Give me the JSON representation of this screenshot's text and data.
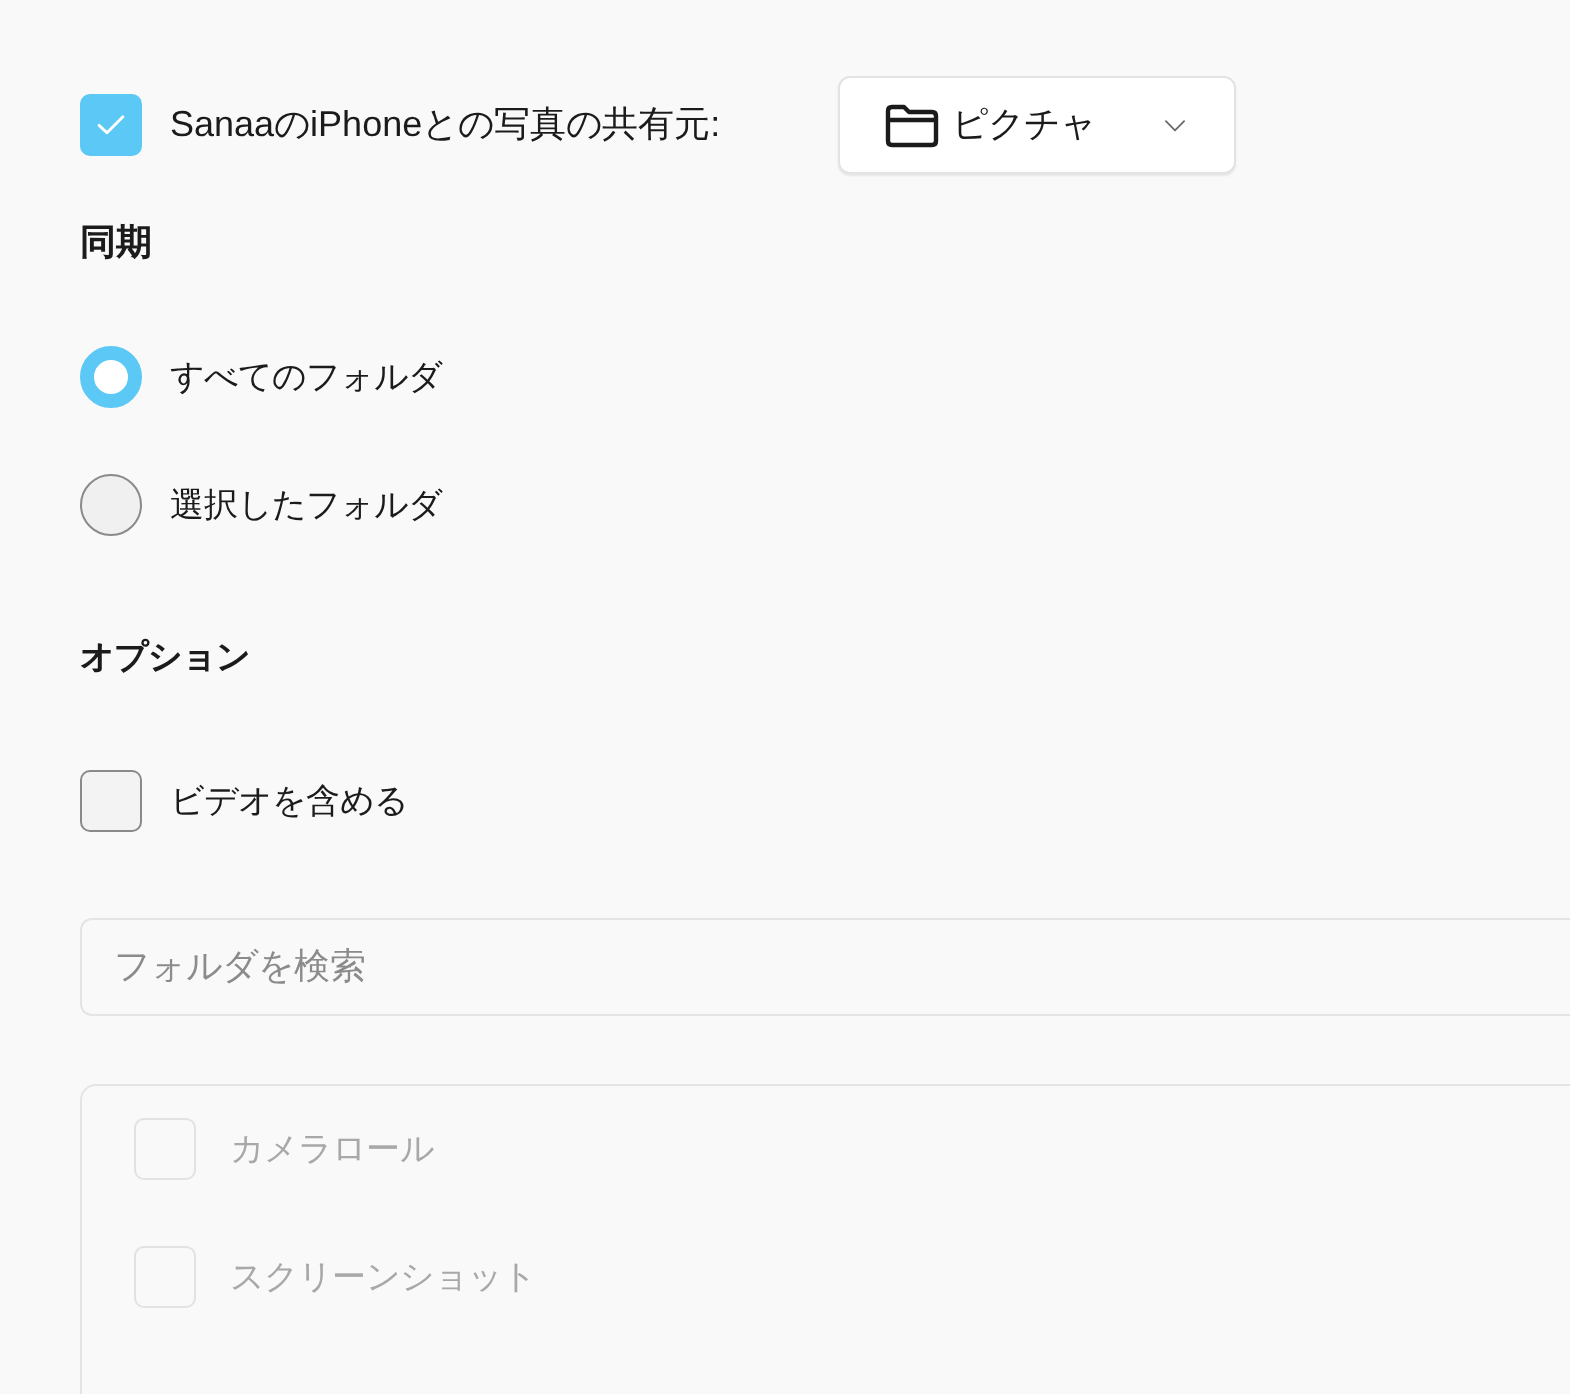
{
  "share_row": {
    "checked": true,
    "label": "SanaaのiPhoneとの写真の共有元:",
    "dropdown": {
      "value": "ピクチャ"
    }
  },
  "sync": {
    "heading": "同期",
    "options": [
      {
        "label": "すべてのフォルダ",
        "selected": true
      },
      {
        "label": "選択したフォルダ",
        "selected": false
      }
    ]
  },
  "options": {
    "heading": "オプション",
    "items": [
      {
        "label": "ビデオを含める",
        "checked": false
      }
    ]
  },
  "folder_search": {
    "placeholder": "フォルダを検索"
  },
  "folder_list": {
    "disabled": true,
    "items": [
      {
        "label": "カメラロール",
        "checked": false
      },
      {
        "label": "スクリーンショット",
        "checked": false
      }
    ]
  }
}
